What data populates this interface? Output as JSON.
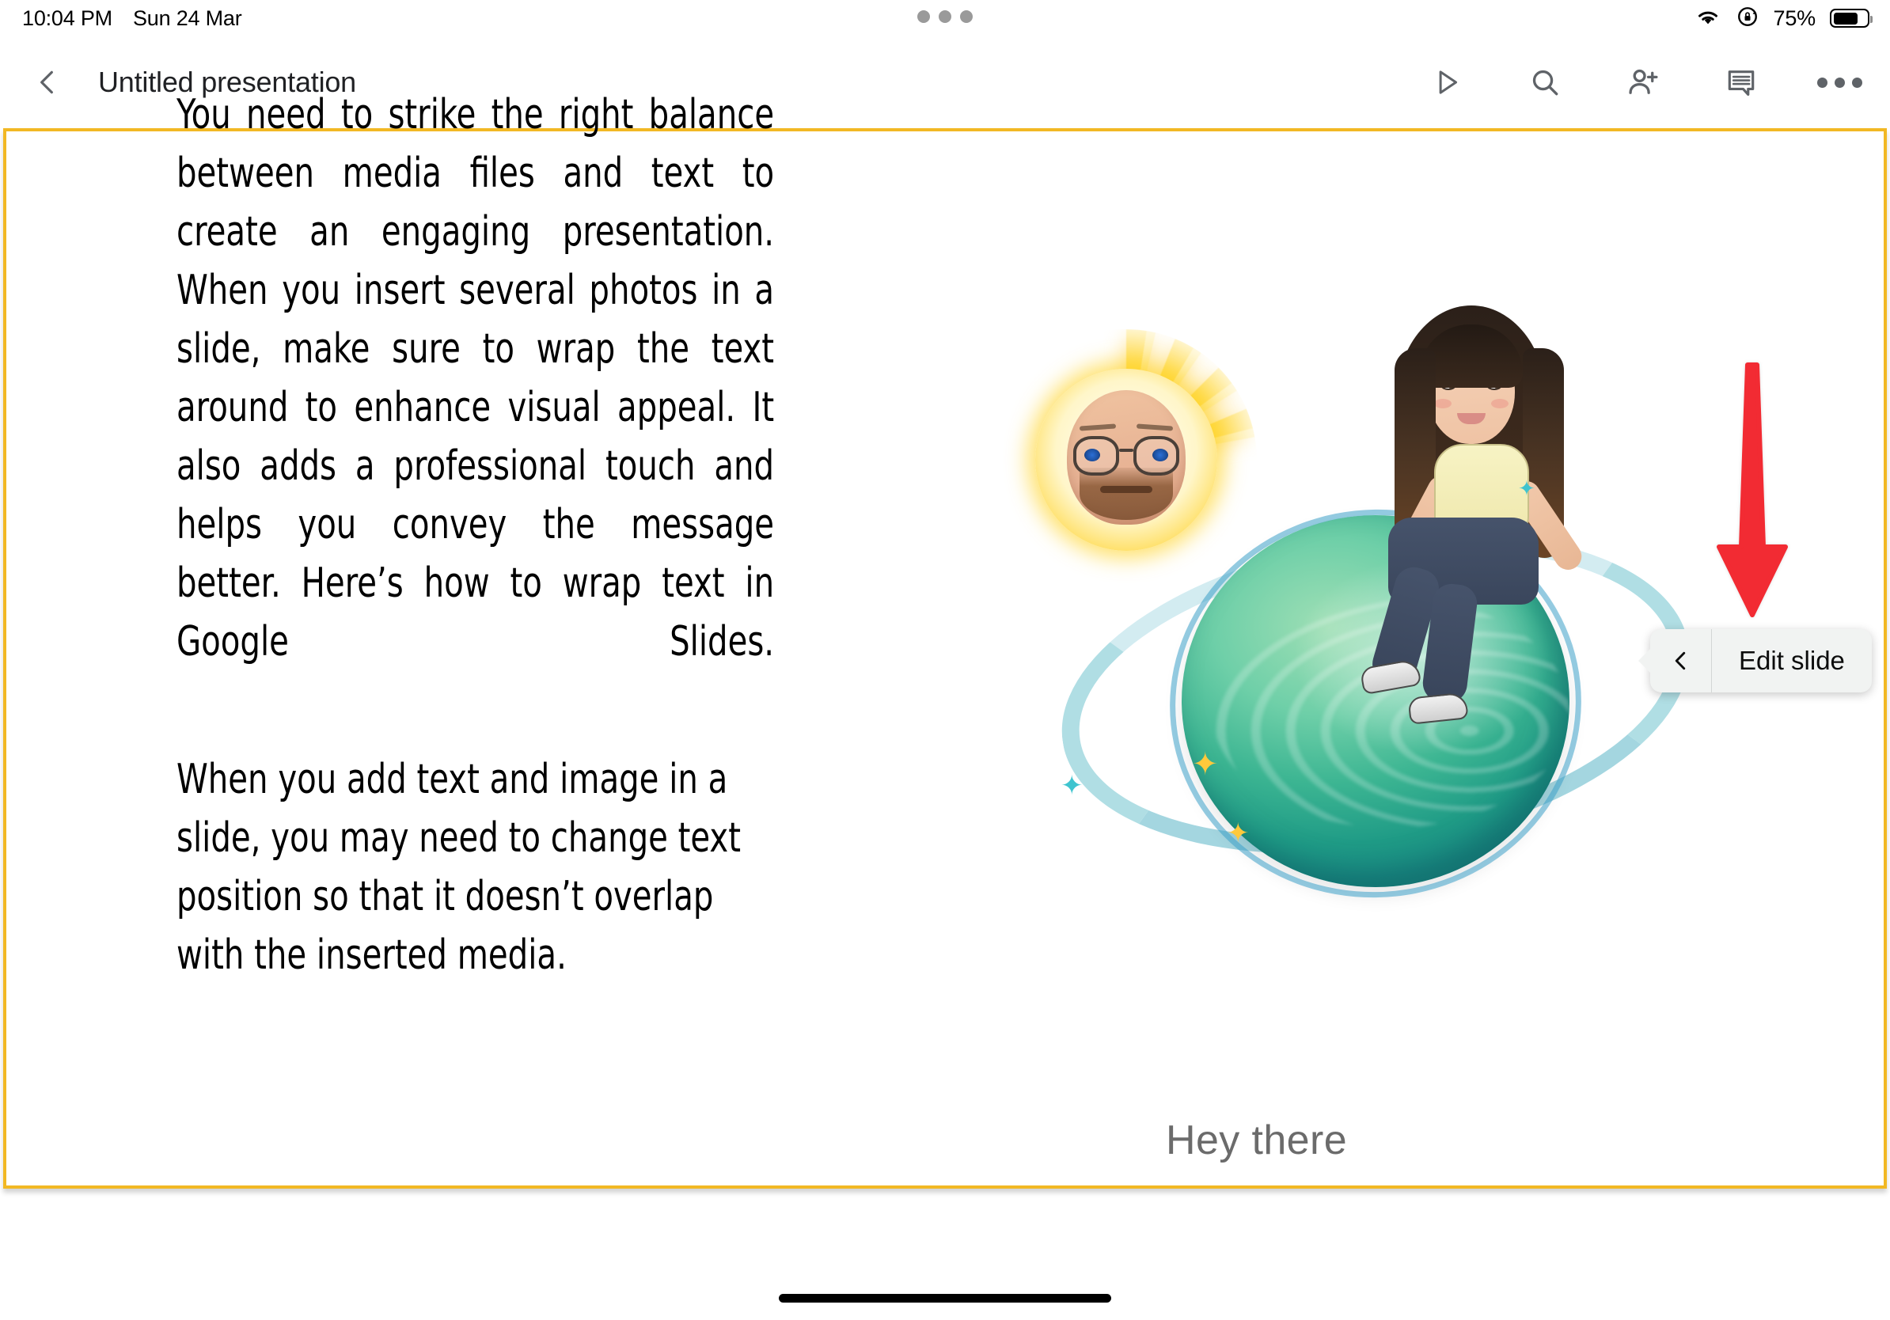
{
  "status_bar": {
    "time": "10:04 PM",
    "date": "Sun 24 Mar",
    "battery_percent": "75%",
    "icons": [
      "wifi-icon",
      "rotation-lock-icon",
      "battery-icon"
    ],
    "multitask_dots": "multitasking-dots"
  },
  "toolbar": {
    "back_label": "back-chevron",
    "title": "Untitled presentation",
    "actions": [
      {
        "name": "present-button",
        "icon": "play-triangle-icon"
      },
      {
        "name": "search-button",
        "icon": "magnifier-icon"
      },
      {
        "name": "share-button",
        "icon": "add-person-icon"
      },
      {
        "name": "comments-button",
        "icon": "comment-icon"
      },
      {
        "name": "more-options-button",
        "icon": "three-dots-icon"
      }
    ]
  },
  "slide": {
    "border_color": "#f2b824",
    "paragraphs": [
      "You need to strike the right balance between media files and text to create an engaging presentation. When you insert several photos in a slide, make sure to wrap the text around to enhance visual appeal. It also adds a professional touch and helps you convey the message better. Here’s how to wrap text in Google Slides.",
      "When you add text and image in a slide, you may need to change text position so that it doesn’t overlap with the inserted media."
    ],
    "image_caption": "Hey there",
    "artwork": {
      "name": "bitmoji-planet-illustration",
      "elements": [
        "sun-face-bitmoji",
        "girl-sitting-on-planet-bitmoji",
        "planet-ring",
        "sparkles"
      ]
    }
  },
  "annotation": {
    "arrow_color": "#f22b33",
    "arrow_name": "red-down-arrow"
  },
  "popover": {
    "back_icon": "back-chevron-icon",
    "item_label": "Edit slide"
  }
}
